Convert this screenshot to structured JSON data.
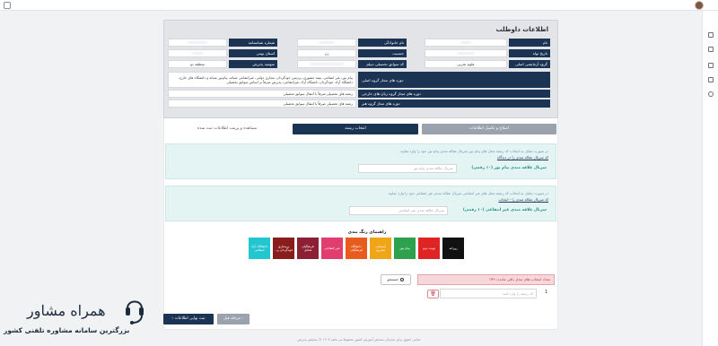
{
  "candidate_info": {
    "title": "اطلاعات داوطلب",
    "fields": [
      {
        "label": "نام",
        "value": "•••••"
      },
      {
        "label": "نام خانوادگی",
        "value": "•••••••"
      },
      {
        "label": "شماره شناسنامه",
        "value": "•••••••••"
      },
      {
        "label": "تاریخ تولد",
        "value": "••••••••"
      },
      {
        "label": "جنسیت",
        "value": "زن"
      },
      {
        "label": "استان بومی",
        "value": "•••••"
      },
      {
        "label": "گروه آزمایشی اصلی",
        "value": "علوم تجربی"
      },
      {
        "label": "کد سوابق تحصیلی دیپلم",
        "value": "••••••••••••••••"
      },
      {
        "label": "سهمیه پذیرش",
        "value": "منطقه دو"
      }
    ],
    "groups": [
      {
        "label": "دوره های مجاز گروه اصلی",
        "value": "پیام نور، غیر انتفاعی، نیمه حضوری، پردیس خودگردان، مجازی دولتی، غیرانتفاعی شبانه، پیام‌نور شبانه و دانشگاه های خارج، دانشگاه آزاد، خودگردان دانشگاه آزاد، غیرانتفاعی، پذیرش صرفاً بر اساس سوابق تحصیلی"
      },
      {
        "label": "دوره های مجاز گروه زبان های خارجی",
        "value": "رشته های تحصیلی صرفاً با انتقال سوابق تحصیلی"
      },
      {
        "label": "دوره های مجاز گروه هنر",
        "value": "رشته های تحصیلی صرفاً با انتقال سوابق تحصیلی"
      }
    ]
  },
  "tabs": {
    "edit_info": "اصلاح و تکمیل اطلاعات",
    "choose_major": "انتخاب رشته",
    "view_info": "مشاهده و پرینت اطلاعات ثبت شده"
  },
  "notices": {
    "payam_noor": {
      "text": "در صورت تمایل به انتخاب کد رشته محل های پیام نور سریال عقاله مندی پیام نور خود را وارد نمایید.",
      "link": "کد سریال عقاله مندی را در دیدگاه",
      "field_label": "سریال علاقه مندی پیام نور (۱۰ رقمی)",
      "placeholder": "سریال علاقه مندی پیام نور"
    },
    "non_profit": {
      "text": "در صورت تمایل به انتخاب کد رشته محل های غیر انتفاعی سریال عقاله مندی غیر انتفاعی خود را وارد نمایید.",
      "link": "کد سریال عقاله مندی را - انتخاب",
      "field_label": "سریال علاقه مندی غیر انتفاعی (۱۰ رقمی)",
      "placeholder": "سریال علاقه مندی غیر انتفاعی"
    }
  },
  "legend": {
    "title": "راهنمای رنگ بندی",
    "items": [
      {
        "label": "روزانه",
        "color": "#111111"
      },
      {
        "label": "نوبت دوم",
        "color": "#e02424"
      },
      {
        "label": "پیام نور",
        "color": "#2ea14f"
      },
      {
        "label": "دانشگاه فرهنگیان",
        "color": "#f0a418"
      },
      {
        "label": "غیر انتفاعی",
        "color": "#8d1f35"
      },
      {
        "label": "دانشگاه آزاد اسلامی",
        "color": "#22c6cf"
      },
      {
        "label": "پردیس خودگردان",
        "color": "#ffffff"
      },
      {
        "label": "فرهنگیان شاغل",
        "color": "#8a1c1c"
      },
      {
        "label": "آزمون مجازی",
        "color": "#e85b8a"
      }
    ]
  },
  "legend_order": [
    "روزانه",
    "نوبت دوم",
    "پیام نور",
    "آسمانی محروم",
    "دانشگاه فرهنگیان",
    "غیر انتفاعی",
    "فرهنگیان شاغل",
    "پرستاری خودگردان و...",
    "دانشگاه آزاد اسلامی"
  ],
  "selection": {
    "count_label": "تعداد انتخاب های مجاز باقی مانده: ۱۴۹",
    "search_label": "جستجو",
    "row_placeholder": "کد رشته را وارد کنید",
    "row_index": "1",
    "plus": "+",
    "delete": "🗑"
  },
  "buttons": {
    "final_submit": "ثبت نهایی اطلاعات",
    "prev_step": "مرحله قبل"
  },
  "footer": "تمامی حقوق برای سازمان سنجش آموزش کشور محفوظ می باشد ۱۴۰۳ © سنجش پذیرش",
  "brand": {
    "title": "همراه مشاور",
    "subtitle": "بزرگترین سامانه مشاوره تلفنی کشور"
  }
}
